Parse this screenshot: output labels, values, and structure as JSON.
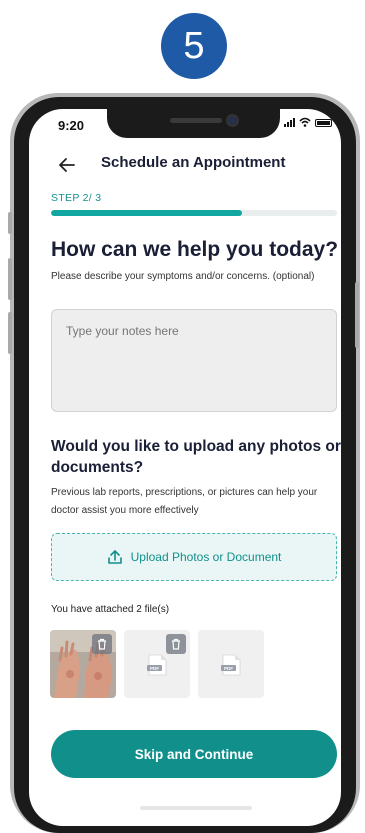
{
  "step_badge": "5",
  "status_bar": {
    "time": "9:20"
  },
  "header": {
    "title": "Schedule an Appointment"
  },
  "progress": {
    "label": "STEP 2/ 3",
    "fraction": 0.667
  },
  "question": {
    "title": "How can we help you today?",
    "description": "Please describe your symptoms and/or concerns. (optional)"
  },
  "notes": {
    "placeholder": "Type your notes here",
    "value": ""
  },
  "upload": {
    "title": "Would you like to upload any photos or documents?",
    "description": "Previous lab reports, prescriptions, or pictures can help your doctor assist you more effectively",
    "button_label": "Upload Photos or Document"
  },
  "attachments": {
    "label": "You have attached 2 file(s)",
    "files": [
      {
        "kind": "photo",
        "removable": true
      },
      {
        "kind": "pdf",
        "removable": true
      },
      {
        "kind": "pdf",
        "removable": false
      }
    ]
  },
  "pdf_icon_text": "PDF",
  "actions": {
    "skip_continue": "Skip and Continue"
  },
  "colors": {
    "accent": "#11908b",
    "badge": "#1f5aa6",
    "progress_fill": "#11a6a0"
  }
}
